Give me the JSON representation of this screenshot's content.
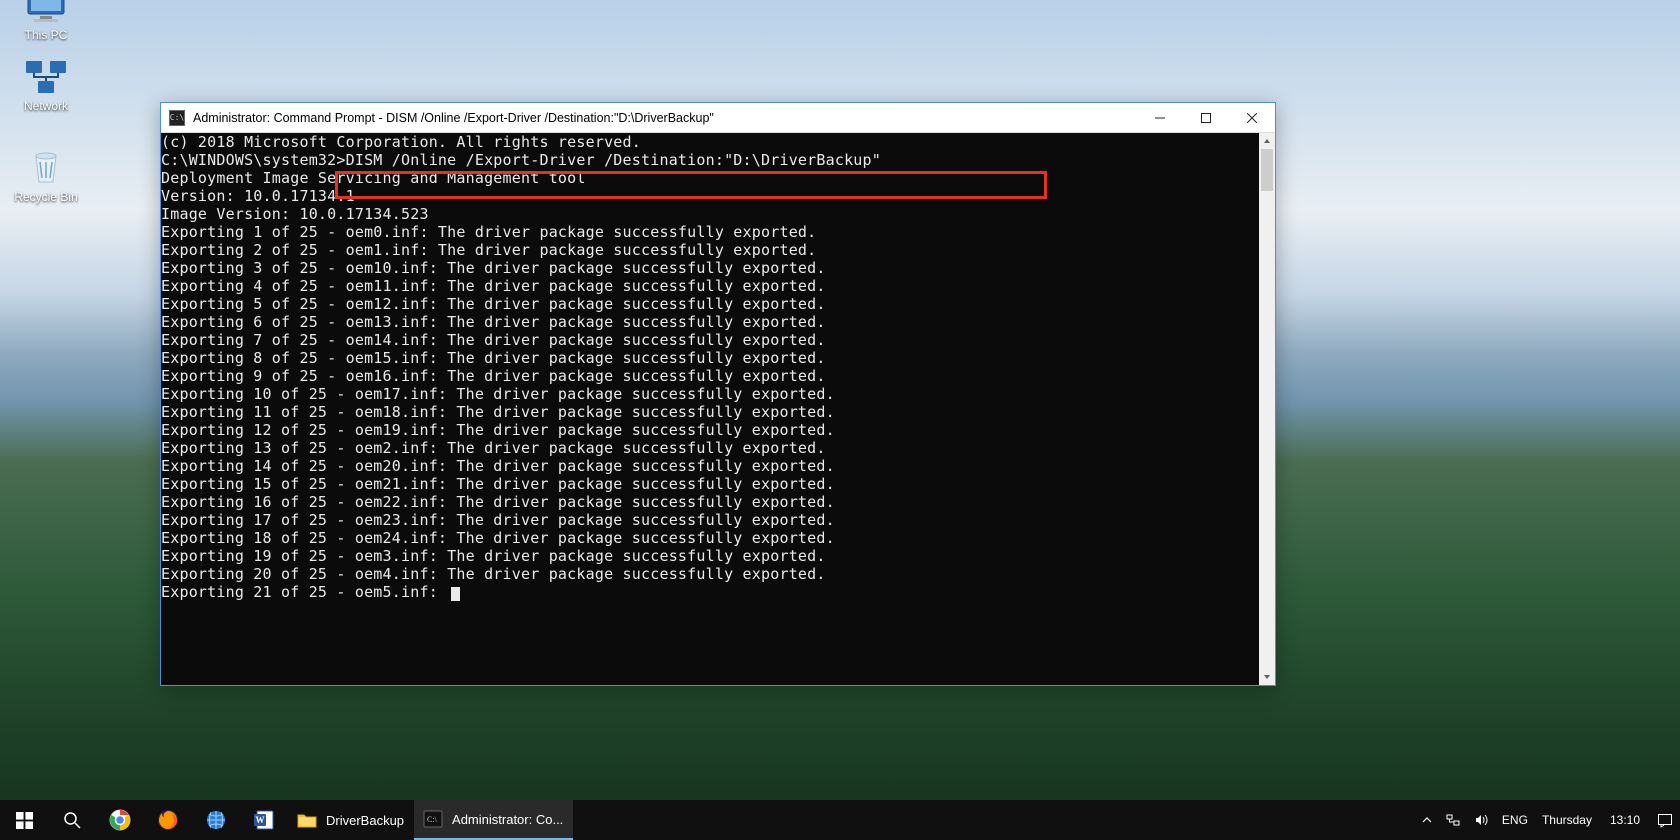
{
  "desktop": {
    "icons": [
      {
        "label": "This PC"
      },
      {
        "label": "Network"
      },
      {
        "label": "Recycle Bin"
      }
    ]
  },
  "window": {
    "title": "Administrator: Command Prompt - DISM  /Online /Export-Driver /Destination:\"D:\\DriverBackup\"",
    "console": {
      "copyright": "(c) 2018 Microsoft Corporation. All rights reserved.",
      "prompt_prefix": "C:\\WINDOWS\\system32>",
      "command": "DISM /Online /Export-Driver /Destination:\"D:\\DriverBackup\"",
      "tool_line": "Deployment Image Servicing and Management tool",
      "version_line": "Version: 10.0.17134.1",
      "image_version_line": "Image Version: 10.0.17134.523",
      "export_total": 25,
      "export_msg": "The driver package successfully exported.",
      "exports": [
        {
          "n": 1,
          "file": "oem0.inf",
          "done": true
        },
        {
          "n": 2,
          "file": "oem1.inf",
          "done": true
        },
        {
          "n": 3,
          "file": "oem10.inf",
          "done": true
        },
        {
          "n": 4,
          "file": "oem11.inf",
          "done": true
        },
        {
          "n": 5,
          "file": "oem12.inf",
          "done": true
        },
        {
          "n": 6,
          "file": "oem13.inf",
          "done": true
        },
        {
          "n": 7,
          "file": "oem14.inf",
          "done": true
        },
        {
          "n": 8,
          "file": "oem15.inf",
          "done": true
        },
        {
          "n": 9,
          "file": "oem16.inf",
          "done": true
        },
        {
          "n": 10,
          "file": "oem17.inf",
          "done": true
        },
        {
          "n": 11,
          "file": "oem18.inf",
          "done": true
        },
        {
          "n": 12,
          "file": "oem19.inf",
          "done": true
        },
        {
          "n": 13,
          "file": "oem2.inf",
          "done": true
        },
        {
          "n": 14,
          "file": "oem20.inf",
          "done": true
        },
        {
          "n": 15,
          "file": "oem21.inf",
          "done": true
        },
        {
          "n": 16,
          "file": "oem22.inf",
          "done": true
        },
        {
          "n": 17,
          "file": "oem23.inf",
          "done": true
        },
        {
          "n": 18,
          "file": "oem24.inf",
          "done": true
        },
        {
          "n": 19,
          "file": "oem3.inf",
          "done": true
        },
        {
          "n": 20,
          "file": "oem4.inf",
          "done": true
        },
        {
          "n": 21,
          "file": "oem5.inf",
          "done": false
        }
      ]
    }
  },
  "taskbar": {
    "apps": [
      {
        "name": "chrome",
        "label": ""
      },
      {
        "name": "firefox",
        "label": ""
      },
      {
        "name": "edge",
        "label": ""
      },
      {
        "name": "word",
        "label": ""
      },
      {
        "name": "explorer",
        "label": "DriverBackup"
      },
      {
        "name": "cmd",
        "label": "Administrator: Co..."
      }
    ],
    "tray": {
      "lang": "ENG",
      "day": "Thursday",
      "time": "13:10"
    }
  }
}
